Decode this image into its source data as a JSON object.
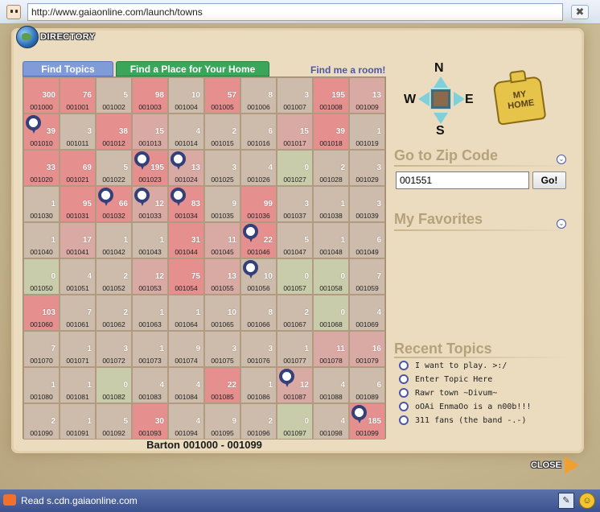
{
  "browser": {
    "url": "http://www.gaiaonline.com/launch/towns",
    "close_glyph": "✖"
  },
  "header": {
    "directory_label": "DIRECTORY"
  },
  "tabs": [
    {
      "label": "Find Topics",
      "color": "#7f9bd8"
    },
    {
      "label": "Find a Place for Your Home",
      "color": "#3aa65a"
    }
  ],
  "find_room_label": "Find me a room!",
  "grid": {
    "town_label": "Barton 001000 - 001099",
    "colors": {
      "red": "#e58f8f",
      "pink": "#d9aaa4",
      "gray": "#cdbcab",
      "green": "#c9ccaa"
    },
    "cells": [
      {
        "n": "300",
        "z": "001000",
        "c": "red"
      },
      {
        "n": "76",
        "z": "001001",
        "c": "red"
      },
      {
        "n": "5",
        "z": "001002",
        "c": "gray"
      },
      {
        "n": "98",
        "z": "001003",
        "c": "red"
      },
      {
        "n": "10",
        "z": "001004",
        "c": "gray"
      },
      {
        "n": "57",
        "z": "001005",
        "c": "red"
      },
      {
        "n": "8",
        "z": "001006",
        "c": "gray"
      },
      {
        "n": "3",
        "z": "001007",
        "c": "gray"
      },
      {
        "n": "195",
        "z": "001008",
        "c": "red"
      },
      {
        "n": "13",
        "z": "001009",
        "c": "pink"
      },
      {
        "n": "39",
        "z": "001010",
        "c": "red",
        "pin": true
      },
      {
        "n": "3",
        "z": "001011",
        "c": "gray"
      },
      {
        "n": "38",
        "z": "001012",
        "c": "red"
      },
      {
        "n": "15",
        "z": "001013",
        "c": "pink"
      },
      {
        "n": "4",
        "z": "001014",
        "c": "gray"
      },
      {
        "n": "2",
        "z": "001015",
        "c": "gray"
      },
      {
        "n": "6",
        "z": "001016",
        "c": "gray"
      },
      {
        "n": "15",
        "z": "001017",
        "c": "pink"
      },
      {
        "n": "39",
        "z": "001018",
        "c": "red"
      },
      {
        "n": "1",
        "z": "001019",
        "c": "gray"
      },
      {
        "n": "33",
        "z": "001020",
        "c": "red"
      },
      {
        "n": "69",
        "z": "001021",
        "c": "red"
      },
      {
        "n": "5",
        "z": "001022",
        "c": "gray"
      },
      {
        "n": "195",
        "z": "001023",
        "c": "red",
        "pin": true
      },
      {
        "n": "13",
        "z": "001024",
        "c": "pink",
        "pin": true
      },
      {
        "n": "3",
        "z": "001025",
        "c": "gray"
      },
      {
        "n": "4",
        "z": "001026",
        "c": "gray"
      },
      {
        "n": "0",
        "z": "001027",
        "c": "green"
      },
      {
        "n": "2",
        "z": "001028",
        "c": "gray"
      },
      {
        "n": "3",
        "z": "001029",
        "c": "gray"
      },
      {
        "n": "1",
        "z": "001030",
        "c": "gray"
      },
      {
        "n": "95",
        "z": "001031",
        "c": "red"
      },
      {
        "n": "66",
        "z": "001032",
        "c": "red",
        "pin": true
      },
      {
        "n": "12",
        "z": "001033",
        "c": "pink",
        "pin": true
      },
      {
        "n": "83",
        "z": "001034",
        "c": "red",
        "pin": true
      },
      {
        "n": "9",
        "z": "001035",
        "c": "gray"
      },
      {
        "n": "99",
        "z": "001036",
        "c": "red"
      },
      {
        "n": "3",
        "z": "001037",
        "c": "gray"
      },
      {
        "n": "1",
        "z": "001038",
        "c": "gray"
      },
      {
        "n": "3",
        "z": "001039",
        "c": "gray"
      },
      {
        "n": "1",
        "z": "001040",
        "c": "gray"
      },
      {
        "n": "17",
        "z": "001041",
        "c": "pink"
      },
      {
        "n": "1",
        "z": "001042",
        "c": "gray"
      },
      {
        "n": "1",
        "z": "001043",
        "c": "gray"
      },
      {
        "n": "31",
        "z": "001044",
        "c": "red"
      },
      {
        "n": "11",
        "z": "001045",
        "c": "pink"
      },
      {
        "n": "22",
        "z": "001046",
        "c": "red",
        "pin": true
      },
      {
        "n": "5",
        "z": "001047",
        "c": "gray"
      },
      {
        "n": "1",
        "z": "001048",
        "c": "gray"
      },
      {
        "n": "6",
        "z": "001049",
        "c": "gray"
      },
      {
        "n": "0",
        "z": "001050",
        "c": "green"
      },
      {
        "n": "4",
        "z": "001051",
        "c": "gray"
      },
      {
        "n": "2",
        "z": "001052",
        "c": "gray"
      },
      {
        "n": "12",
        "z": "001053",
        "c": "pink"
      },
      {
        "n": "75",
        "z": "001054",
        "c": "red"
      },
      {
        "n": "13",
        "z": "001055",
        "c": "pink"
      },
      {
        "n": "10",
        "z": "001056",
        "c": "gray",
        "pin": true
      },
      {
        "n": "0",
        "z": "001057",
        "c": "green"
      },
      {
        "n": "0",
        "z": "001058",
        "c": "green"
      },
      {
        "n": "7",
        "z": "001059",
        "c": "gray"
      },
      {
        "n": "103",
        "z": "001060",
        "c": "red"
      },
      {
        "n": "7",
        "z": "001061",
        "c": "gray"
      },
      {
        "n": "2",
        "z": "001062",
        "c": "gray"
      },
      {
        "n": "1",
        "z": "001063",
        "c": "gray"
      },
      {
        "n": "1",
        "z": "001064",
        "c": "gray"
      },
      {
        "n": "10",
        "z": "001065",
        "c": "gray"
      },
      {
        "n": "8",
        "z": "001066",
        "c": "gray"
      },
      {
        "n": "2",
        "z": "001067",
        "c": "gray"
      },
      {
        "n": "0",
        "z": "001068",
        "c": "green"
      },
      {
        "n": "4",
        "z": "001069",
        "c": "gray"
      },
      {
        "n": "7",
        "z": "001070",
        "c": "gray"
      },
      {
        "n": "1",
        "z": "001071",
        "c": "gray"
      },
      {
        "n": "3",
        "z": "001072",
        "c": "gray"
      },
      {
        "n": "1",
        "z": "001073",
        "c": "gray"
      },
      {
        "n": "9",
        "z": "001074",
        "c": "gray"
      },
      {
        "n": "3",
        "z": "001075",
        "c": "gray"
      },
      {
        "n": "3",
        "z": "001076",
        "c": "gray"
      },
      {
        "n": "1",
        "z": "001077",
        "c": "gray"
      },
      {
        "n": "11",
        "z": "001078",
        "c": "pink"
      },
      {
        "n": "16",
        "z": "001079",
        "c": "pink"
      },
      {
        "n": "1",
        "z": "001080",
        "c": "gray"
      },
      {
        "n": "1",
        "z": "001081",
        "c": "gray"
      },
      {
        "n": "0",
        "z": "001082",
        "c": "green"
      },
      {
        "n": "4",
        "z": "001083",
        "c": "gray"
      },
      {
        "n": "4",
        "z": "001084",
        "c": "gray"
      },
      {
        "n": "22",
        "z": "001085",
        "c": "red"
      },
      {
        "n": "1",
        "z": "001086",
        "c": "gray"
      },
      {
        "n": "12",
        "z": "001087",
        "c": "pink",
        "pin": true
      },
      {
        "n": "4",
        "z": "001088",
        "c": "gray"
      },
      {
        "n": "6",
        "z": "001089",
        "c": "gray"
      },
      {
        "n": "2",
        "z": "001090",
        "c": "gray"
      },
      {
        "n": "1",
        "z": "001091",
        "c": "gray"
      },
      {
        "n": "5",
        "z": "001092",
        "c": "gray"
      },
      {
        "n": "30",
        "z": "001093",
        "c": "red"
      },
      {
        "n": "4",
        "z": "001094",
        "c": "gray"
      },
      {
        "n": "9",
        "z": "001095",
        "c": "gray"
      },
      {
        "n": "2",
        "z": "001096",
        "c": "gray"
      },
      {
        "n": "0",
        "z": "001097",
        "c": "green"
      },
      {
        "n": "4",
        "z": "001098",
        "c": "gray"
      },
      {
        "n": "185",
        "z": "001099",
        "c": "red",
        "pin": true
      }
    ]
  },
  "compass": {
    "n": "N",
    "s": "S",
    "e": "E",
    "w": "W"
  },
  "my_home": {
    "line1": "MY",
    "line2": "HOME"
  },
  "zip": {
    "heading": "Go to Zip Code",
    "value": "001551",
    "go_label": "Go!"
  },
  "favorites": {
    "heading": "My Favorites"
  },
  "recent": {
    "heading": "Recent Topics",
    "items": [
      "I want to play. >:/",
      "Enter Topic Here",
      "Rawr town ~Divum~",
      "oOAi EnmaOo is a n00b!!!",
      "311 fans (the band -.-)"
    ]
  },
  "close_label": "CLOSE",
  "status": {
    "text": "Read s.cdn.gaiaonline.com"
  }
}
